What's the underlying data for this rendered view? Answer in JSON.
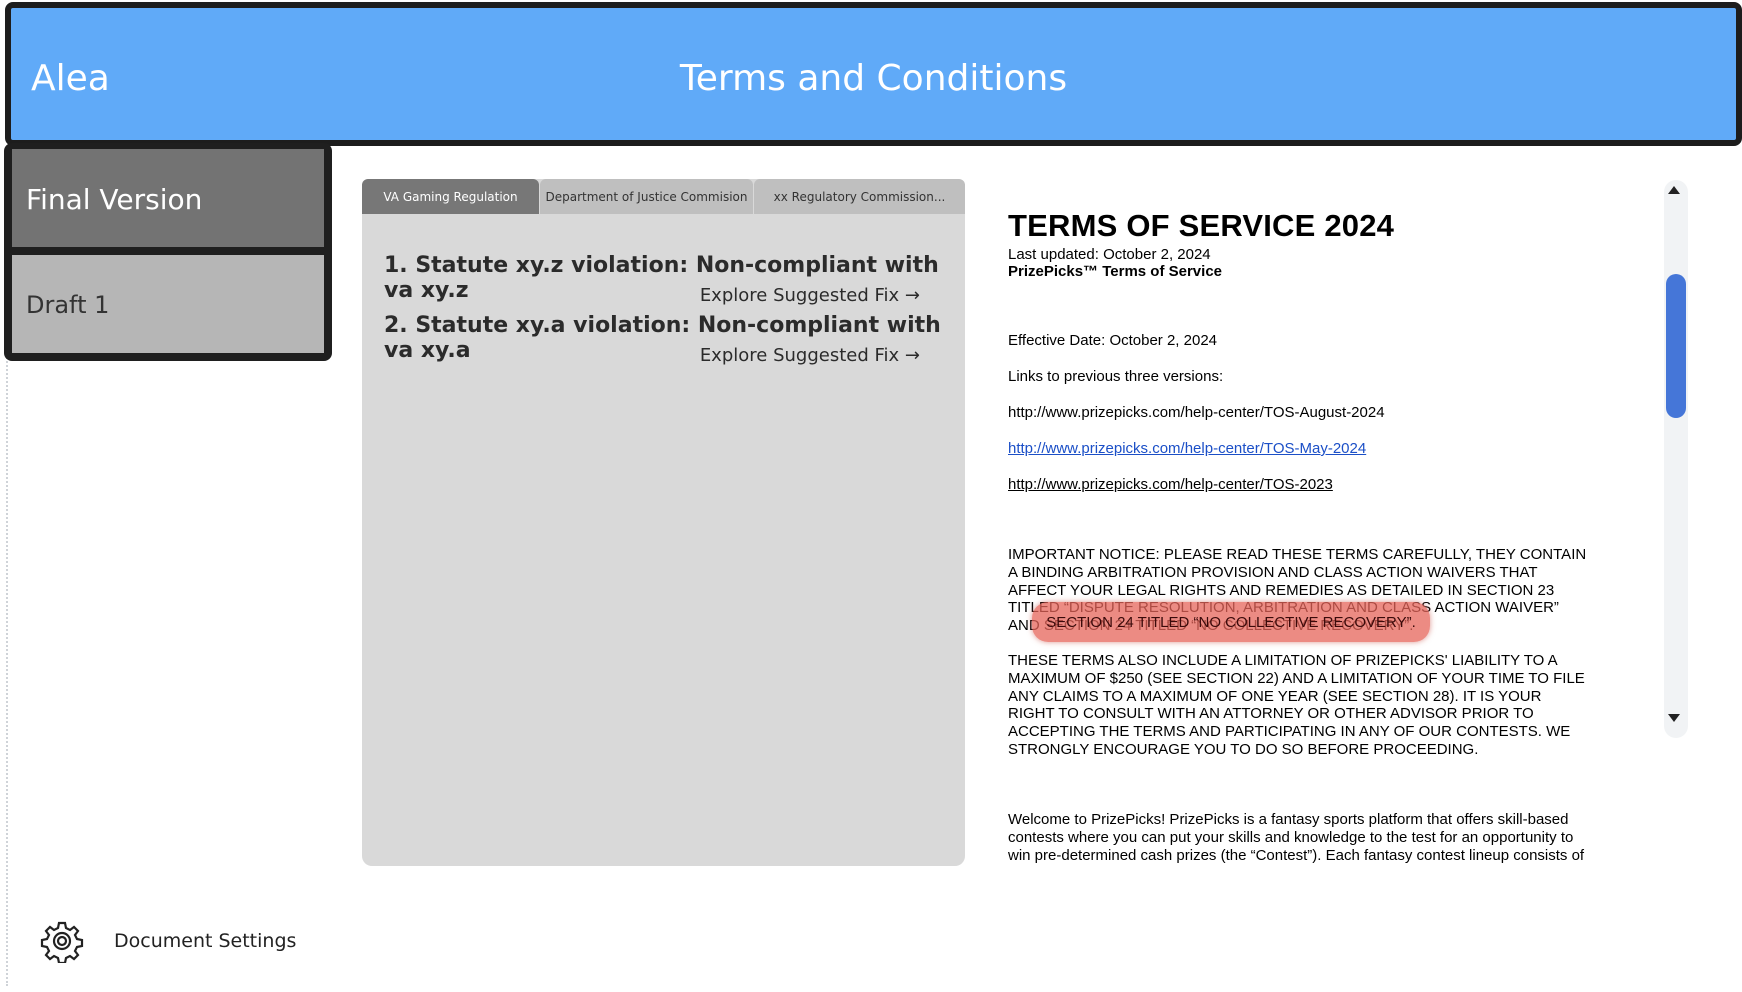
{
  "header": {
    "app_name": "Alea",
    "title": "Terms and Conditions",
    "color": "#60aaf8"
  },
  "versions": {
    "items": [
      {
        "label": "Final Version",
        "selected": true
      },
      {
        "label": "Draft 1",
        "selected": false
      }
    ]
  },
  "issues_panel": {
    "tabs": [
      {
        "label": "VA Gaming Regulation",
        "active": true
      },
      {
        "label": "Department of Justice Commision",
        "active": false
      },
      {
        "label": "xx Regulatory Commission...",
        "active": false
      }
    ],
    "issues": [
      {
        "title": "1. Statute xy.z violation: Non-compliant with va xy.z",
        "fix_label": "Explore Suggested Fix →"
      },
      {
        "title": "2. Statute xy.a violation: Non-compliant with va xy.a",
        "fix_label": "Explore Suggested Fix →"
      }
    ]
  },
  "document": {
    "title": "TERMS OF SERVICE 2024",
    "last_updated": "Last updated: October 2, 2024",
    "subtitle": "PrizePicks™ Terms of Service",
    "effective_date": "Effective Date: October 2, 2024",
    "links_intro": "Links to previous three versions:",
    "links": [
      "http://www.prizepicks.com/help-center/TOS-August-2024",
      "http://www.prizepicks.com/help-center/TOS-May-2024",
      "http://www.prizepicks.com/help-center/TOS-2023"
    ],
    "notice_lines": [
      "IMPORTANT NOTICE: PLEASE READ THESE TERMS CAREFULLY, THEY CONTAIN",
      "A BINDING ARBITRATION PROVISION AND CLASS ACTION WAIVERS THAT",
      "AFFECT YOUR LEGAL RIGHTS AND REMEDIES AS DETAILED IN SECTION 23",
      "TITLED “DISPUTE RESOLUTION, ARBITRATION AND CLASS ACTION WAIVER”",
      "AND SECTION 24 TITLED “NO COLLECTIVE RECOVERY”."
    ],
    "highlight_text": "SECTION 24 TITLED “NO COLLECTIVE RECOVERY”.",
    "limitation_lines": [
      "THESE TERMS ALSO INCLUDE A LIMITATION OF PRIZEPICKS' LIABILITY TO A",
      "MAXIMUM OF $250 (SEE SECTION 22) AND A LIMITATION OF YOUR TIME TO FILE",
      "ANY CLAIMS TO A MAXIMUM OF ONE YEAR (SEE SECTION 28). IT IS YOUR",
      "RIGHT TO CONSULT WITH AN ATTORNEY OR OTHER ADVISOR PRIOR TO",
      "ACCEPTING THE TERMS AND PARTICIPATING IN ANY OF OUR CONTESTS. WE",
      "STRONGLY ENCOURAGE YOU TO DO SO BEFORE PROCEEDING."
    ],
    "welcome_lines": [
      "Welcome to PrizePicks! PrizePicks is a fantasy sports platform that offers skill-based",
      "contests where you can put your skills and knowledge to the test for an opportunity to",
      "win pre-determined cash prizes (the “Contest”). Each fantasy contest lineup consists of"
    ]
  },
  "footer": {
    "settings_label": "Document Settings",
    "settings_icon": "gear-icon"
  }
}
